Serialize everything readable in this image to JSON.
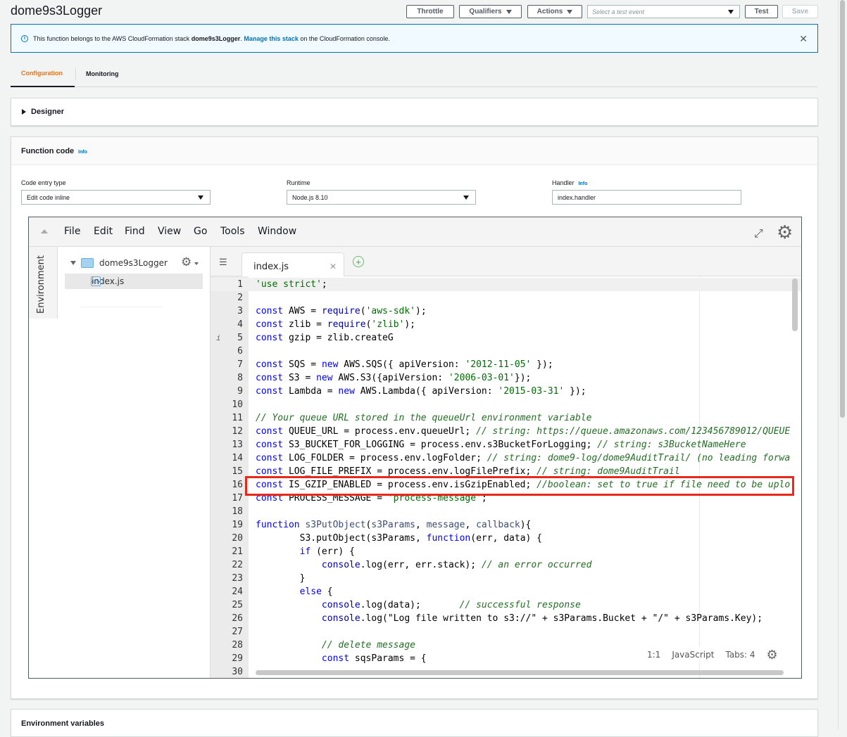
{
  "page": {
    "title": "dome9s3Logger"
  },
  "toolbar": {
    "throttle": "Throttle",
    "qualifiers": "Qualifiers",
    "actions": "Actions",
    "test_event_placeholder": "Select a test event",
    "test": "Test",
    "save": "Save"
  },
  "banner": {
    "prefix": "This function belongs to the AWS CloudFormation stack ",
    "stack": "dome9s3Logger",
    "sep": ". ",
    "link": "Manage this stack",
    "suffix": " on the CloudFormation console."
  },
  "tabs": [
    {
      "label": "Configuration",
      "active": true
    },
    {
      "label": "Monitoring",
      "active": false
    }
  ],
  "designer": {
    "label": "Designer"
  },
  "function_code": {
    "title": "Function code",
    "info": "Info",
    "code_entry": {
      "label": "Code entry type",
      "value": "Edit code inline"
    },
    "runtime": {
      "label": "Runtime",
      "value": "Node.js 8.10"
    },
    "handler": {
      "label": "Handler",
      "info": "Info",
      "value": "index.handler"
    }
  },
  "editor": {
    "menu": [
      "File",
      "Edit",
      "Find",
      "View",
      "Go",
      "Tools",
      "Window"
    ],
    "environment_label": "Environment",
    "tree": {
      "root": "dome9s3Logger",
      "file": "index.js"
    },
    "tab": {
      "label": "index.js"
    },
    "status": {
      "position": "1:1",
      "mode": "JavaScript",
      "tabs": "Tabs: 4"
    },
    "lines": [
      {
        "n": "1",
        "segs": [
          [
            "str",
            "'use strict'"
          ],
          [
            "",
            "; "
          ]
        ]
      },
      {
        "n": "2",
        "segs": []
      },
      {
        "n": "3",
        "segs": [
          [
            "kw",
            "const"
          ],
          [
            "",
            " AWS = "
          ],
          [
            "sup",
            "require"
          ],
          [
            "",
            "("
          ],
          [
            "str",
            "'aws-sdk'"
          ],
          [
            "",
            ");"
          ]
        ]
      },
      {
        "n": "4",
        "segs": [
          [
            "kw",
            "const"
          ],
          [
            "",
            " zlib = "
          ],
          [
            "sup",
            "require"
          ],
          [
            "",
            "("
          ],
          [
            "str",
            "'zlib'"
          ],
          [
            "",
            ");"
          ]
        ]
      },
      {
        "n": "5",
        "info": "i",
        "segs": [
          [
            "kw",
            "const"
          ],
          [
            "",
            " gzip = zlib.createG"
          ]
        ]
      },
      {
        "n": "6",
        "segs": []
      },
      {
        "n": "7",
        "segs": [
          [
            "kw",
            "const"
          ],
          [
            "",
            " SQS = "
          ],
          [
            "kw",
            "new"
          ],
          [
            "",
            " AWS.SQS({ apiVersion: "
          ],
          [
            "str",
            "'2012-11-05'"
          ],
          [
            "",
            " });"
          ]
        ]
      },
      {
        "n": "8",
        "segs": [
          [
            "kw",
            "const"
          ],
          [
            "",
            " S3 = "
          ],
          [
            "kw",
            "new"
          ],
          [
            "",
            " AWS.S3({apiVersion: "
          ],
          [
            "str",
            "'2006-03-01'"
          ],
          [
            "",
            "});"
          ]
        ]
      },
      {
        "n": "9",
        "segs": [
          [
            "kw",
            "const"
          ],
          [
            "",
            " Lambda = "
          ],
          [
            "kw",
            "new"
          ],
          [
            "",
            " AWS.Lambda({ apiVersion: "
          ],
          [
            "str",
            "'2015-03-31'"
          ],
          [
            "",
            " });"
          ]
        ]
      },
      {
        "n": "10",
        "segs": []
      },
      {
        "n": "11",
        "segs": [
          [
            "cm",
            "// Your queue URL stored in the queueUrl environment variable"
          ]
        ]
      },
      {
        "n": "12",
        "segs": [
          [
            "kw",
            "const"
          ],
          [
            "",
            " QUEUE_URL = process.env.queueUrl; "
          ],
          [
            "cm",
            "// string: https://queue.amazonaws.com/123456789012/QUEUE"
          ]
        ]
      },
      {
        "n": "13",
        "segs": [
          [
            "kw",
            "const"
          ],
          [
            "",
            " S3_BUCKET_FOR_LOGGING = process.env.s3BucketForLogging; "
          ],
          [
            "cm",
            "// string: s3BucketNameHere"
          ]
        ]
      },
      {
        "n": "14",
        "segs": [
          [
            "kw",
            "const"
          ],
          [
            "",
            " LOG_FOLDER = process.env.logFolder; "
          ],
          [
            "cm",
            "// string: dome9-log/dome9AuditTrail/ (no leading forwa"
          ]
        ]
      },
      {
        "n": "15",
        "segs": [
          [
            "kw",
            "const"
          ],
          [
            "",
            " LOG_FILE_PREFIX = process.env.logFilePrefix; "
          ],
          [
            "cm",
            "// string: dome9AuditTrail"
          ]
        ]
      },
      {
        "n": "16",
        "segs": [
          [
            "kw",
            "const"
          ],
          [
            "",
            " IS_GZIP_ENABLED = process.env.isGzipEnabled; "
          ],
          [
            "cm",
            "//boolean: set to true if file need to be uplo"
          ]
        ]
      },
      {
        "n": "17",
        "segs": [
          [
            "kw",
            "const"
          ],
          [
            "",
            " PROCESS_MESSAGE = "
          ],
          [
            "str",
            "'process-message'"
          ],
          [
            "",
            ";"
          ]
        ]
      },
      {
        "n": "18",
        "segs": []
      },
      {
        "n": "19",
        "segs": [
          [
            "kw",
            "function"
          ],
          [
            "",
            " "
          ],
          [
            "fn",
            "s3PutObject"
          ],
          [
            "",
            "("
          ],
          [
            "fn",
            "s3Params"
          ],
          [
            "",
            ", "
          ],
          [
            "fn",
            "message"
          ],
          [
            "",
            ", "
          ],
          [
            "fn",
            "callback"
          ],
          [
            "",
            "){"
          ]
        ]
      },
      {
        "n": "20",
        "segs": [
          [
            "",
            "        S3.putObject(s3Params, "
          ],
          [
            "kw",
            "function"
          ],
          [
            "",
            "(err, data) {"
          ]
        ]
      },
      {
        "n": "21",
        "segs": [
          [
            "",
            "        "
          ],
          [
            "kw",
            "if"
          ],
          [
            "",
            " (err) {"
          ]
        ]
      },
      {
        "n": "22",
        "segs": [
          [
            "",
            "            "
          ],
          [
            "sup",
            "console"
          ],
          [
            "",
            ".log(err, err.stack); "
          ],
          [
            "cm",
            "// an error occurred"
          ]
        ]
      },
      {
        "n": "23",
        "segs": [
          [
            "",
            "        }"
          ]
        ]
      },
      {
        "n": "24",
        "segs": [
          [
            "",
            "        "
          ],
          [
            "kw",
            "else"
          ],
          [
            "",
            " {"
          ]
        ]
      },
      {
        "n": "25",
        "segs": [
          [
            "",
            "            "
          ],
          [
            "sup",
            "console"
          ],
          [
            "",
            ".log(data);       "
          ],
          [
            "cm",
            "// successful response"
          ]
        ]
      },
      {
        "n": "26",
        "segs": [
          [
            "",
            "            "
          ],
          [
            "sup",
            "console"
          ],
          [
            "",
            ".log(\"Log file written to s3://\" + s3Params.Bucket + \"/\" + s3Params.Key);"
          ]
        ]
      },
      {
        "n": "27",
        "segs": []
      },
      {
        "n": "28",
        "segs": [
          [
            "",
            "            "
          ],
          [
            "cm",
            "// delete message"
          ]
        ]
      },
      {
        "n": "29",
        "segs": [
          [
            "",
            "            "
          ],
          [
            "kw",
            "const"
          ],
          [
            "",
            " sqsParams = {"
          ]
        ]
      },
      {
        "n": "30",
        "segs": []
      }
    ]
  },
  "env_vars": {
    "title": "Environment variables"
  },
  "colors": {
    "accent": "#ec7211",
    "link": "#0073bb",
    "highlight": "#e8281b"
  }
}
